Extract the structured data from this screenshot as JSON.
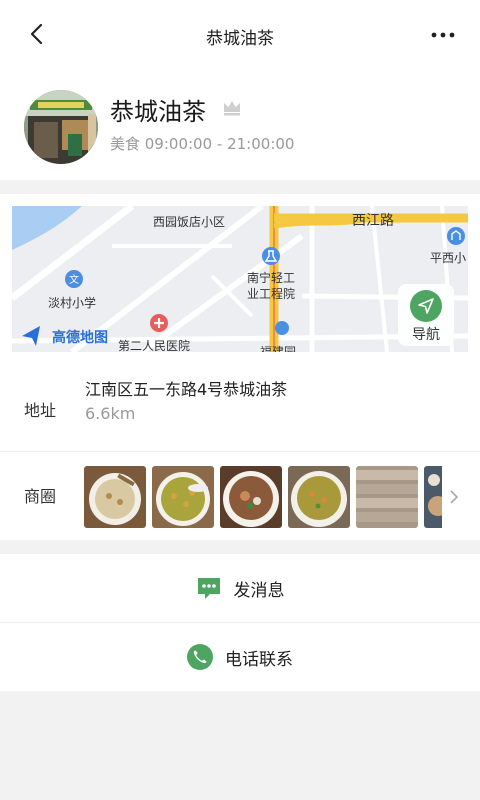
{
  "header": {
    "title": "恭城油茶",
    "back_icon": "back-arrow-icon",
    "more_icon": "more-dots-icon"
  },
  "profile": {
    "name": "恭城油茶",
    "category_hours": "美食 09:00:00 - 21:00:00",
    "badge_icon": "crown-icon"
  },
  "map": {
    "labels": {
      "xiyuan": "西园饭店小区",
      "xijiang": "西江路",
      "pingxi": "平西小",
      "nanning": "南宁轻工",
      "nanning2": "业工程院",
      "dancun": "淡村小学",
      "hospital": "第二人民医院",
      "fujian": "福建园",
      "logo": "高德地图"
    },
    "nav_label": "导航"
  },
  "address": {
    "label": "地址",
    "text": "江南区五一东路4号恭城油茶",
    "distance": "6.6km"
  },
  "business_circle": {
    "label": "商圈"
  },
  "actions": {
    "message": "发消息",
    "call": "电话联系"
  },
  "colors": {
    "accent_green": "#4ea561",
    "map_road_yellow": "#f5c842",
    "map_water": "#a9cdf3"
  }
}
